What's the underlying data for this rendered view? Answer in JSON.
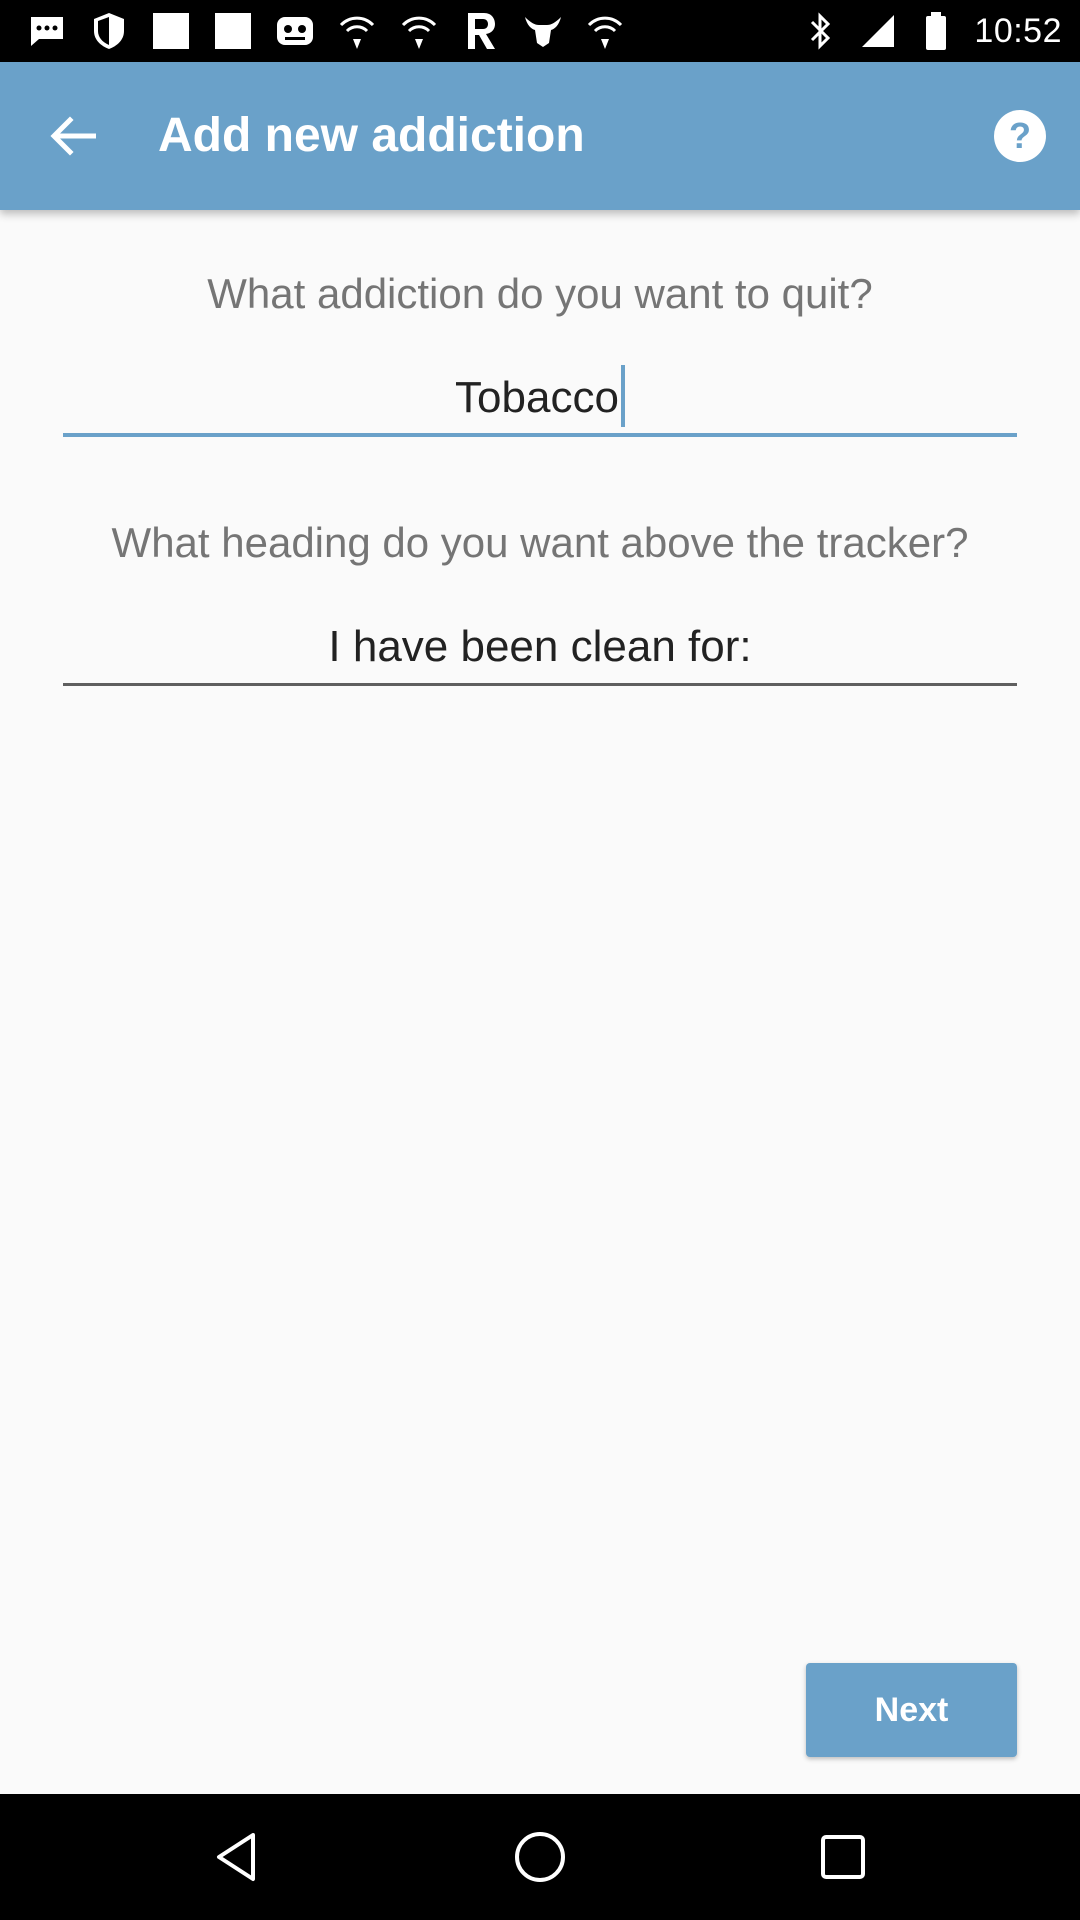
{
  "status_bar": {
    "time": "10:52",
    "left_icons": [
      "message-icon",
      "shield-icon",
      "blank-square-icon",
      "blank-square-icon",
      "gamepad-icon",
      "wifi-icon",
      "wifi-icon",
      "r-app-icon",
      "bull-icon",
      "wifi-icon"
    ],
    "right_icons": [
      "bluetooth-icon",
      "signal-icon",
      "battery-icon"
    ]
  },
  "app_bar": {
    "title": "Add new addiction",
    "background_color": "#6aa1c9"
  },
  "form": {
    "addiction_question": "What addiction do you want to quit?",
    "addiction_value": "Tobacco",
    "heading_question": "What heading do you want above the tracker?",
    "heading_value": "I have been clean for:"
  },
  "actions": {
    "next_label": "Next"
  },
  "colors": {
    "accent": "#6aa1c9",
    "text_secondary": "#757575",
    "background": "#fafafa"
  }
}
